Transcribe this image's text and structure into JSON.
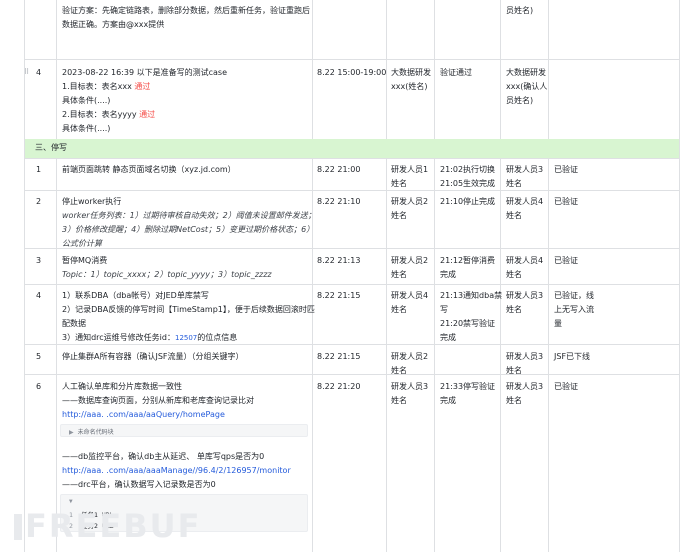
{
  "top_fragment": {
    "line1": "验证方案：先确定链路表，删除部分数据，然后重新任务，验证重跑后",
    "line2": "数据正确。方案由@xxx提供",
    "confirmer_suffix": "员姓名)"
  },
  "row_test": {
    "num": "4",
    "line1": "2023-08-22 16:39 以下是准备写的测试case",
    "t1_prefix": "1.目标表：表名xxx ",
    "t1_status": "通过",
    "cond1": "具体条件(....)",
    "t2_prefix": "2.目标表：表名yyyy ",
    "t2_status": "通过",
    "cond2": "具体条件(....)",
    "time": "8.22  15:00-19:00",
    "owner": [
      "大数据研发",
      "xxx(姓名)"
    ],
    "result": "验证通过",
    "confirmer": [
      "大数据研发",
      "xxx(确认人",
      "员姓名)"
    ]
  },
  "section_title": "三、停写",
  "rows": [
    {
      "num": "1",
      "content": [
        "前端页面跳转 静态页面域名切换（xyz.jd.com）"
      ],
      "time": "8.22 21:00",
      "owner": [
        "研发人员1",
        "姓名"
      ],
      "result": [
        "21:02执行切换",
        "21:05生效完成"
      ],
      "confirmer": [
        "研发人员3",
        "姓名"
      ],
      "status": [
        "已验证"
      ]
    },
    {
      "num": "2",
      "content_title": "停止worker执行",
      "content_italic": [
        "worker任务列表：1）过期待审核自动失效；2）阈值未设置邮件发送；",
        "3）价格修改提醒；4）删除过期NetCost；5）变更过期价格状态；6）",
        "公式价计算"
      ],
      "time": "8.22 21:10",
      "owner": [
        "研发人员2",
        "姓名"
      ],
      "result": [
        "21:10停止完成"
      ],
      "confirmer": [
        "研发人员4",
        "姓名"
      ],
      "status": [
        "已验证"
      ]
    },
    {
      "num": "3",
      "content_title": "暂停MQ消费",
      "content_italic": [
        "Topic：1）topic_xxxx；2）topic_yyyy；3）topic_zzzz"
      ],
      "time": "8.22 21:13",
      "owner": [
        "研发人员2",
        "姓名"
      ],
      "result": [
        "21:12暂停消费",
        "完成"
      ],
      "confirmer": [
        "研发人员4",
        "姓名"
      ],
      "status": [
        "已验证"
      ]
    },
    {
      "num": "4",
      "content": [
        "1）联系DBA（dba帐号）对JED单库禁写",
        "2）记录DBA反馈的停写时间【TimeStamp1】，便于后续数据回滚时匹",
        "配数据"
      ],
      "content_last_prefix": "3）通知drc运维号修改任务id：",
      "content_last_id": "12507",
      "content_last_suffix": "的位点信息",
      "time": "8.22 21:15",
      "owner": [
        "研发人员4",
        "姓名"
      ],
      "result": [
        "21:13通知dba禁",
        "写",
        "21:20禁写验证",
        "完成"
      ],
      "confirmer": [
        "研发人员3",
        "姓名"
      ],
      "status": [
        "已验证，线",
        "上无写入流",
        "量"
      ]
    },
    {
      "num": "5",
      "content": [
        "停止集群A所有容器（确认JSF流量）（分组关键字）"
      ],
      "time": "8.22 21:15",
      "owner": [
        "研发人员2",
        "姓名"
      ],
      "result": [],
      "confirmer": [
        "研发人员3",
        "姓名"
      ],
      "status": [
        "JSF已下线"
      ]
    },
    {
      "num": "6",
      "content": [
        "人工确认单库和分片库数据一致性",
        "——数据库查询页面，分别从新库和老库查询记录比对"
      ],
      "link1": "http://aaa.  .com/aaa/aaQuery/homePage",
      "code_label": "未命名代码块",
      "db_line": "——db监控平台，确认db主从延迟、   单库写qps是否为0",
      "link2": "http://aaa.  .com/aaa/aaaManage//96.4/2/126957/monitor",
      "drc_line": "——drc平台，确认数据写入记录数是否为0",
      "code_lines": [
        {
          "n": "1",
          "text": "任务1 URL"
        },
        {
          "n": "2",
          "text": "任务2 URL"
        }
      ],
      "time": "8.22 21:20",
      "owner": [
        "研发人员3",
        "姓名"
      ],
      "result": [
        "21:33停写验证",
        "完成"
      ],
      "confirmer": [
        "研发人员3",
        "姓名"
      ],
      "status": [
        "已验证"
      ]
    }
  ],
  "watermark": "FREEBUF",
  "colors": {
    "section_bg": "#d8f5d1",
    "grid": "#dee0e3",
    "status_red": "#f54a45",
    "link": "#245bdb"
  }
}
